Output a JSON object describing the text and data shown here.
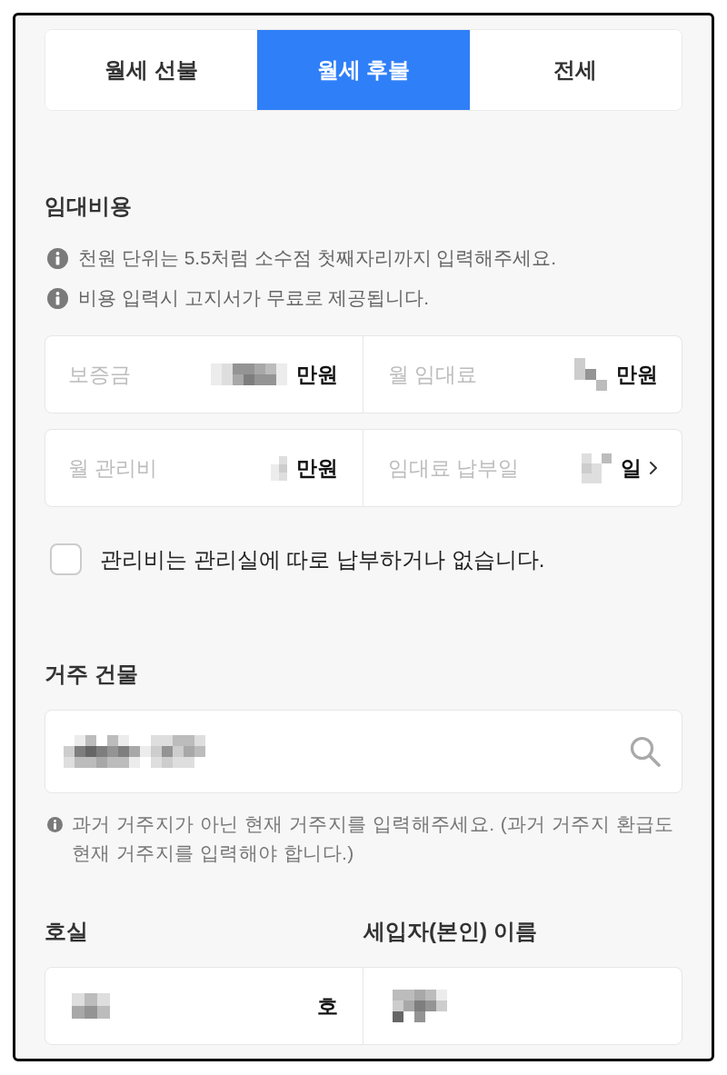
{
  "tabs": [
    {
      "label": "월세 선불",
      "selected": false
    },
    {
      "label": "월세 후불",
      "selected": true
    },
    {
      "label": "전세",
      "selected": false
    }
  ],
  "rent_cost": {
    "heading": "임대비용",
    "notes": [
      "천원 단위는 5.5처럼 소수점 첫째자리까지 입력해주세요.",
      "비용 입력시 고지서가 무료로 제공됩니다."
    ],
    "fields": [
      {
        "kind": "amount",
        "label": "보증금",
        "value_redacted": true,
        "unit": "만원"
      },
      {
        "kind": "amount",
        "label": "월 임대료",
        "value_redacted": true,
        "unit": "만원"
      },
      {
        "kind": "amount",
        "label": "월 관리비",
        "value_redacted": true,
        "unit": "만원"
      },
      {
        "kind": "day",
        "label": "임대료 납부일",
        "value_redacted": true,
        "unit": "일"
      }
    ],
    "checkbox": {
      "label": "관리비는 관리실에 따로 납부하거나 없습니다.",
      "checked": false
    }
  },
  "building": {
    "heading": "거주 건물",
    "search": {
      "value_redacted": true
    },
    "note": "과거 거주지가 아닌 현재 거주지를 입력해주세요. (과거 거주지 환급도 현재 거주지를 입력해야 합니다.)"
  },
  "unit_and_tenant": [
    {
      "heading": "호실",
      "value_redacted": true,
      "unit": "호"
    },
    {
      "heading": "세입자(본인) 이름",
      "value_redacted": true
    }
  ]
}
